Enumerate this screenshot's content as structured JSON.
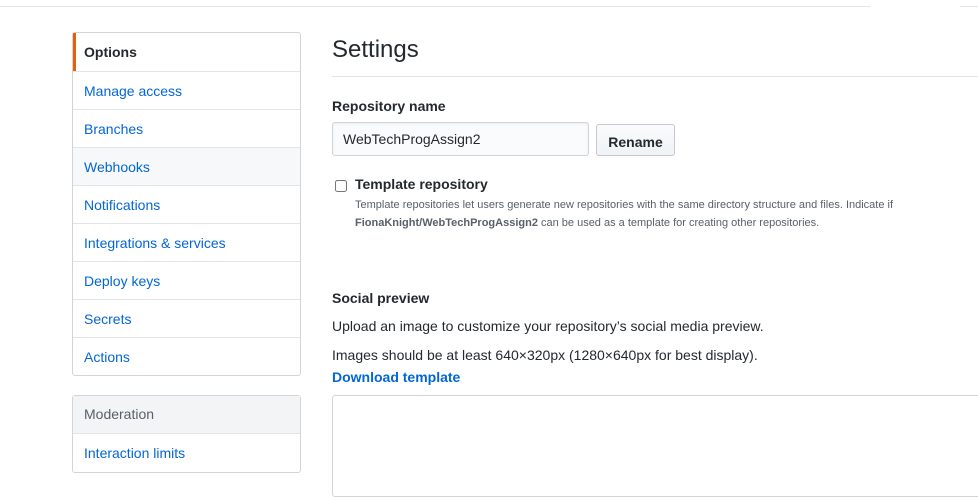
{
  "sidebar": {
    "items": [
      {
        "label": "Options"
      },
      {
        "label": "Manage access"
      },
      {
        "label": "Branches"
      },
      {
        "label": "Webhooks"
      },
      {
        "label": "Notifications"
      },
      {
        "label": "Integrations & services"
      },
      {
        "label": "Deploy keys"
      },
      {
        "label": "Secrets"
      },
      {
        "label": "Actions"
      }
    ],
    "moderation": {
      "heading": "Moderation",
      "items": [
        {
          "label": "Interaction limits"
        }
      ]
    }
  },
  "main": {
    "title": "Settings",
    "repo_name": {
      "label": "Repository name",
      "value": "WebTechProgAssign2",
      "button": "Rename"
    },
    "template": {
      "label": "Template repository",
      "checked": false,
      "note_prefix": "Template repositories let users generate new repositories with the same directory structure and files. Indicate if",
      "note_repo": "FionaKnight/WebTechProgAssign2",
      "note_suffix": " can be used as a template for creating other repositories."
    },
    "social": {
      "label": "Social preview",
      "description": "Upload an image to customize your repository’s social media preview.",
      "requirements": "Images should be at least 640×320px (1280×640px for best display).",
      "download_link": "Download template"
    }
  },
  "colors": {
    "link": "#0366d6",
    "selected_accent": "#e36209",
    "border": "#d1d5da"
  }
}
